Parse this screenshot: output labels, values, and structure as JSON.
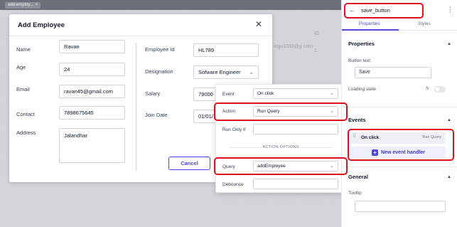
{
  "canvas": {
    "component_tag": "add-employ...",
    "component_tag_close": "×",
    "bg_cells": [
      "ID",
      "ingu1032@g com",
      "1"
    ]
  },
  "modal": {
    "title": "Add Employee",
    "close_glyph": "✕",
    "left_fields": [
      {
        "label": "Name",
        "value": "Ravan"
      },
      {
        "label": "Age",
        "value": "24"
      },
      {
        "label": "Email",
        "value": "ravan45@gmail.com"
      },
      {
        "label": "Contact",
        "value": "7898675645"
      },
      {
        "label": "Address",
        "value": "Jalandhar"
      }
    ],
    "right_fields": [
      {
        "label": "Employee Id",
        "value": "HL789"
      },
      {
        "label": "Designation",
        "value": "Sofware Engineer"
      },
      {
        "label": "Salary",
        "value": "79000"
      },
      {
        "label": "Join Date",
        "value": "01/01/"
      }
    ],
    "cancel_label": "Cancel"
  },
  "event_popover": {
    "event": {
      "label": "Event",
      "value": "On click"
    },
    "action": {
      "label": "Action",
      "value": "Run Query"
    },
    "run_only_if": {
      "label": "Run Only If",
      "value": ""
    },
    "section_title": "ACTION OPTIONS",
    "query": {
      "label": "Query",
      "value": "addEmployee"
    },
    "debounce": {
      "label": "Debounce",
      "value": ""
    }
  },
  "inspector": {
    "component_name": "save_button",
    "tabs": [
      "Properties",
      "Styles"
    ],
    "active_tab": "Properties",
    "properties": {
      "section_title": "Properties",
      "button_text_label": "Button text",
      "button_text_value": "Save",
      "loading_state_label": "Loading state",
      "fx_label": "fx"
    },
    "events": {
      "section_title": "Events",
      "handlers": [
        {
          "event": "On click",
          "action": "Run Query"
        }
      ],
      "new_handler_label": "New event handler"
    },
    "general": {
      "section_title": "General",
      "tooltip_label": "Tooltip"
    }
  },
  "colors": {
    "accent": "#4f46e5",
    "highlight": "#e0101e",
    "canvas_bg": "#d3d5da"
  }
}
